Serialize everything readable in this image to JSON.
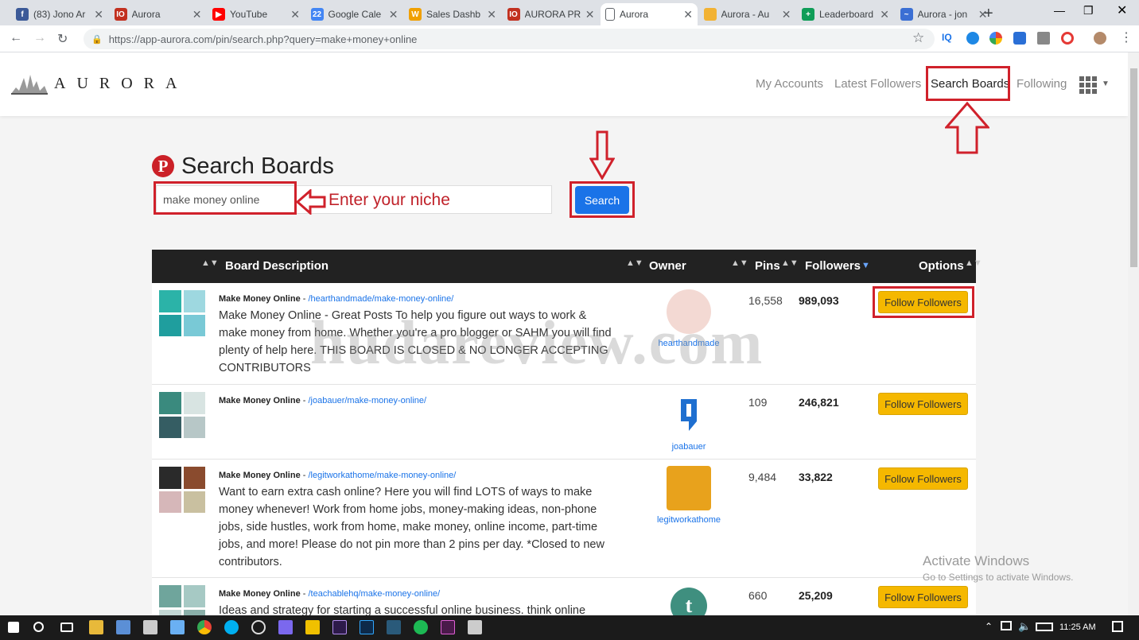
{
  "browser": {
    "tabs": [
      {
        "title": "(83) Jono Ar",
        "icon": "facebook-icon",
        "color": "#3b5998",
        "glyph": "f"
      },
      {
        "title": "Aurora",
        "icon": "aurora-icon",
        "color": "#c2301f",
        "glyph": "IO"
      },
      {
        "title": "YouTube",
        "icon": "youtube-icon",
        "color": "#ff0000",
        "glyph": "▶"
      },
      {
        "title": "Google Cale",
        "icon": "calendar-icon",
        "color": "#4285f4",
        "glyph": "22"
      },
      {
        "title": "Sales Dashb",
        "icon": "dashboard-icon",
        "color": "#f0a000",
        "glyph": "W"
      },
      {
        "title": "AURORA PR",
        "icon": "aurora-icon",
        "color": "#c2301f",
        "glyph": "IO"
      },
      {
        "title": "Aurora",
        "icon": "page-icon",
        "color": "#ffffff",
        "glyph": ""
      },
      {
        "title": "Aurora - Au",
        "icon": "aurora-color-icon",
        "color": "#f2b233",
        "glyph": ""
      },
      {
        "title": "Leaderboard",
        "icon": "sheets-icon",
        "color": "#0f9d58",
        "glyph": "+"
      },
      {
        "title": "Aurora - jon",
        "icon": "aurora-blue-icon",
        "color": "#3b6fd4",
        "glyph": "~"
      }
    ],
    "url": "https://app-aurora.com/pin/search.php?query=make+money+online"
  },
  "nav": {
    "logo_text": "AURORA",
    "links": [
      "My Accounts",
      "Latest Followers",
      "Search Boards",
      "Following"
    ]
  },
  "search": {
    "title": "Search Boards",
    "value": "make money online",
    "button": "Search",
    "hint": "Enter your niche"
  },
  "table": {
    "headers": {
      "description": "Board Description",
      "owner": "Owner",
      "pins": "Pins",
      "followers": "Followers",
      "options": "Options"
    },
    "rows": [
      {
        "title": "Make Money Online",
        "link": "/hearthandmade/make-money-online/",
        "description": "Make Money Online - Great Posts To help you figure out ways to work & make money from home. Whether you're a pro blogger or SAHM you will find plenty of help here. THIS BOARD IS CLOSED & NO LONGER ACCEPTING CONTRIBUTORS",
        "owner": "hearthandmade",
        "pins": "16,558",
        "followers": "989,093",
        "button": "Follow Followers",
        "avatar_color": "#f3d9d3",
        "thumb_colors": [
          "#2bb3a8",
          "#9ed8e0",
          "#1f9e9e",
          "#79c9d6"
        ]
      },
      {
        "title": "Make Money Online",
        "link": "/joabauer/make-money-online/",
        "description": "",
        "owner": "joabauer",
        "pins": "109",
        "followers": "246,821",
        "button": "Follow Followers",
        "avatar_color": "#ffffff",
        "thumb_colors": [
          "#3a8a7e",
          "#d8e4e2",
          "#355d63",
          "#b7c7c7"
        ]
      },
      {
        "title": "Make Money Online",
        "link": "/legitworkathome/make-money-online/",
        "description": "Want to earn extra cash online? Here you will find LOTS of ways to make money whenever! Work from home jobs, money-making ideas, non-phone jobs, side hustles, work from home, make money, online income, part-time jobs, and more! Please do not pin more than 2 pins per day. *Closed to new contributors.",
        "owner": "legitworkathome",
        "pins": "9,484",
        "followers": "33,822",
        "button": "Follow Followers",
        "avatar_color": "#e8a21c",
        "thumb_colors": [
          "#2a2a2a",
          "#8a4b2e",
          "#d6b7b9",
          "#c9c0a0"
        ]
      },
      {
        "title": "Make Money Online",
        "link": "/teachablehq/make-money-online/",
        "description": "Ideas and strategy for starting a successful online business. think online",
        "owner": "",
        "pins": "660",
        "followers": "25,209",
        "button": "Follow Followers",
        "avatar_color": "#3f8f7f",
        "thumb_colors": [
          "#6fa59c",
          "#a6c9c4",
          "#c4d8d5",
          "#8bb0aa"
        ]
      }
    ]
  },
  "overlay": {
    "watermark": "hudareview.com",
    "activate_title": "Activate Windows",
    "activate_sub": "Go to Settings to activate Windows."
  },
  "taskbar": {
    "time": "11:25 AM"
  },
  "colors": {
    "accent_blue": "#1a73e8",
    "annotation_red": "#d0212b",
    "follow_yellow": "#f5b800",
    "table_header": "#222222"
  }
}
